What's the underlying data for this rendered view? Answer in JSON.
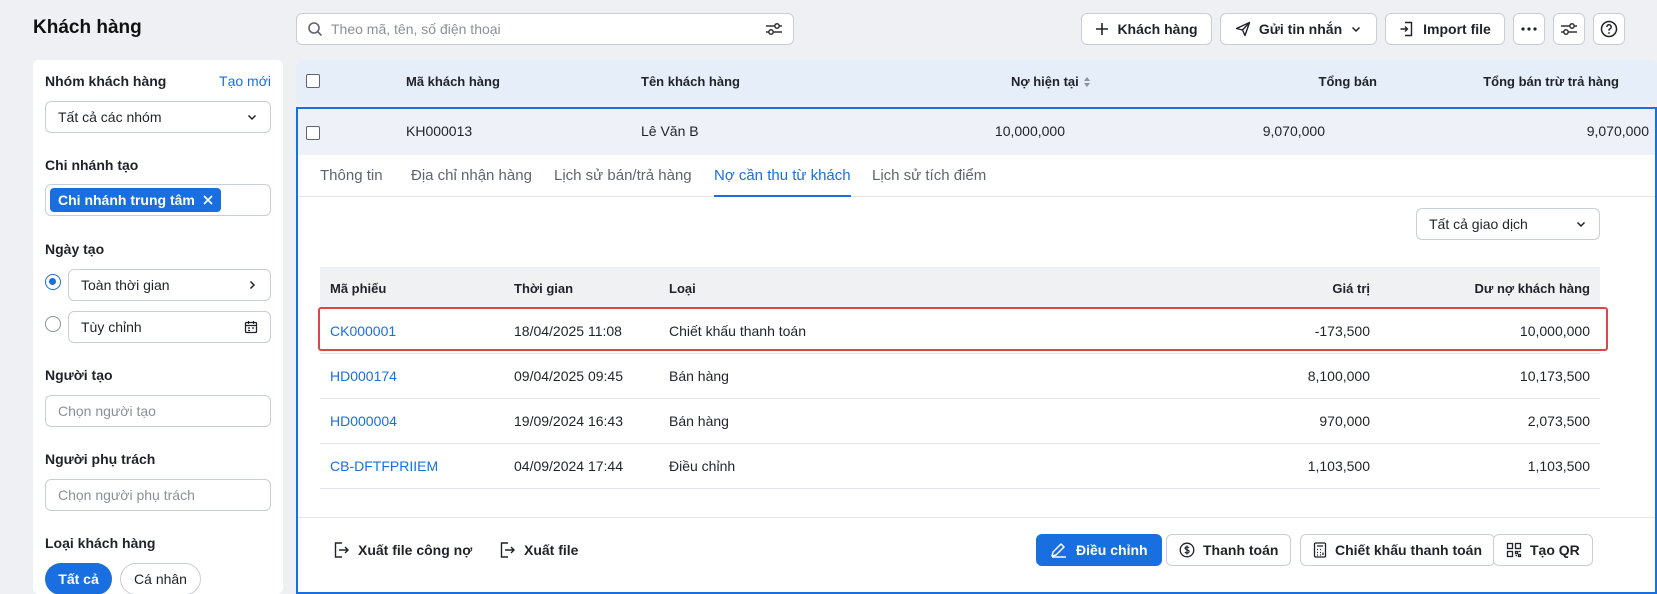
{
  "header": {
    "title": "Khách hàng",
    "search_placeholder": "Theo mã, tên, số điện thoại",
    "add_customer": "Khách hàng",
    "send_message": "Gửi tin nhắn",
    "import_file": "Import file"
  },
  "sidebar": {
    "group_label": "Nhóm khách hàng",
    "group_create": "Tạo mới",
    "group_value": "Tất cả các nhóm",
    "branch_label": "Chi nhánh tạo",
    "branch_chip": "Chi nhánh trung tâm",
    "date_label": "Ngày tạo",
    "date_all": "Toàn thời gian",
    "date_custom": "Tùy chỉnh",
    "creator_label": "Người tạo",
    "creator_placeholder": "Chọn người tạo",
    "owner_label": "Người phụ trách",
    "owner_placeholder": "Chọn người phụ trách",
    "type_label": "Loại khách hàng",
    "type_all": "Tất cả",
    "type_personal": "Cá nhân"
  },
  "table": {
    "columns": [
      "Mã khách hàng",
      "Tên khách hàng",
      "Nợ hiện tại",
      "Tổng bán",
      "Tổng bán trừ trả hàng"
    ],
    "row": {
      "code": "KH000013",
      "name": "Lê Văn B",
      "debt": "10,000,000",
      "total_sales": "9,070,000",
      "net_sales": "9,070,000"
    }
  },
  "detail": {
    "tabs": [
      "Thông tin",
      "Địa chỉ nhận hàng",
      "Lịch sử bán/trả hàng",
      "Nợ cần thu từ khách",
      "Lịch sử tích điểm"
    ],
    "active_tab": 3,
    "filter_value": "Tất cả giao dịch",
    "columns": [
      "Mã phiếu",
      "Thời gian",
      "Loại",
      "Giá trị",
      "Dư nợ khách hàng"
    ],
    "rows": [
      {
        "code": "CK000001",
        "time": "18/04/2025 11:08",
        "type": "Chiết khấu thanh toán",
        "value": "-173,500",
        "balance": "10,000,000"
      },
      {
        "code": "HD000174",
        "time": "09/04/2025 09:45",
        "type": "Bán hàng",
        "value": "8,100,000",
        "balance": "10,173,500"
      },
      {
        "code": "HD000004",
        "time": "19/09/2024 16:43",
        "type": "Bán hàng",
        "value": "970,000",
        "balance": "2,073,500"
      },
      {
        "code": "CB-DFTFPRIIEM",
        "time": "04/09/2024 17:44",
        "type": "Điều chỉnh",
        "value": "1,103,500",
        "balance": "1,103,500"
      }
    ],
    "footer": {
      "export_debt": "Xuất file công nợ",
      "export_file": "Xuất file",
      "adjust": "Điều chỉnh",
      "payment": "Thanh toán",
      "discount": "Chiết khấu thanh toán",
      "qr": "Tạo QR"
    }
  },
  "colors": {
    "accent": "#1a6fe0",
    "highlight": "#e04545"
  }
}
